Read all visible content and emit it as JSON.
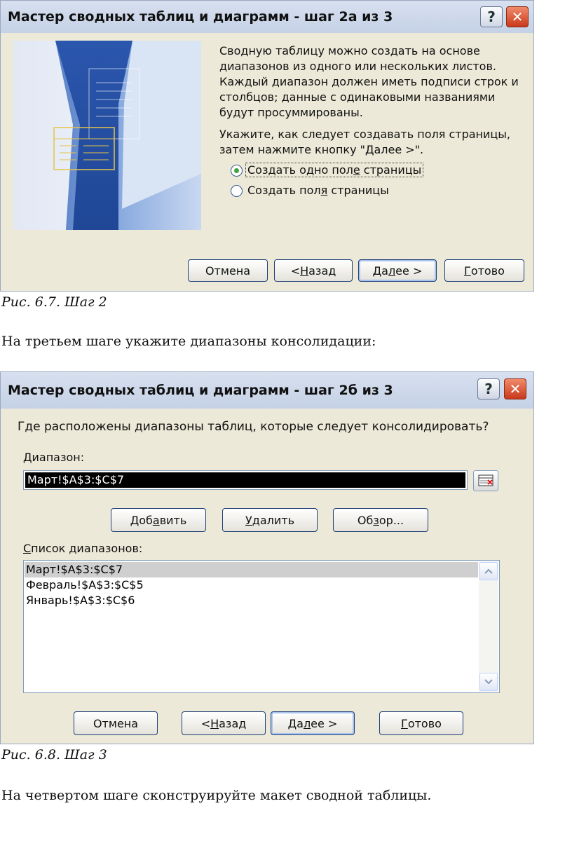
{
  "dialog1": {
    "title": "Мастер сводных таблиц и диаграмм - шаг 2а из 3",
    "help_label": "?",
    "close_label": "✕",
    "desc_lines": [
      "Сводную таблицу можно создать на основе",
      "диапазонов из одного или нескольких листов.",
      "Каждый диапазон должен иметь подписи строк и",
      "столбцов; данные с одинаковыми названиями",
      "будут просуммированы."
    ],
    "instr_lines": [
      "Укажите, как следует создавать поля страницы,",
      "затем нажмите кнопку \"Далее >\"."
    ],
    "option1": {
      "pre": "Создать одно пол",
      "u": "е",
      "post": " страницы",
      "selected": true
    },
    "option2": {
      "pre": "Создать пол",
      "u": "я",
      "post": " страницы",
      "selected": false
    },
    "buttons": {
      "cancel": "Отмена",
      "back": {
        "pre": "< ",
        "u": "Н",
        "post": "азад"
      },
      "next": {
        "pre": "Да",
        "u": "л",
        "post": "ее >"
      },
      "finish": {
        "pre": "",
        "u": "Г",
        "post": "отово"
      }
    }
  },
  "caption1": "Рис. 6.7.  Шаг 2",
  "para1": "На третьем шаге укажите диапазоны консолидации:",
  "dialog2": {
    "title": "Мастер сводных таблиц и диаграмм - шаг 2б из 3",
    "help_label": "?",
    "close_label": "✕",
    "question": "Где расположены диапазоны таблиц, которые следует консолидировать?",
    "range_label": {
      "pre": "",
      "u": "Д",
      "post": "иапазон:"
    },
    "range_value": "Март!$A$3:$C$7",
    "add": {
      "pre": "Доб",
      "u": "а",
      "post": "вить"
    },
    "delete": {
      "pre": "",
      "u": "У",
      "post": "далить"
    },
    "browse": {
      "pre": "Об",
      "u": "з",
      "post": "ор..."
    },
    "list_label": {
      "pre": "",
      "u": "С",
      "post": "писок диапазонов:"
    },
    "ranges": [
      "Март!$A$3:$C$7",
      "Февраль!$A$3:$C$5",
      "Январь!$A$3:$C$6"
    ],
    "selected_index": 0,
    "buttons": {
      "cancel": "Отмена",
      "back": {
        "pre": "< ",
        "u": "Н",
        "post": "азад"
      },
      "next": {
        "pre": "Да",
        "u": "л",
        "post": "ее >"
      },
      "finish": {
        "pre": "",
        "u": "Г",
        "post": "отово"
      }
    }
  },
  "caption2": "Рис. 6.8.  Шаг 3",
  "para2": "На четвертом шаге сконструируйте макет сводной таблицы."
}
